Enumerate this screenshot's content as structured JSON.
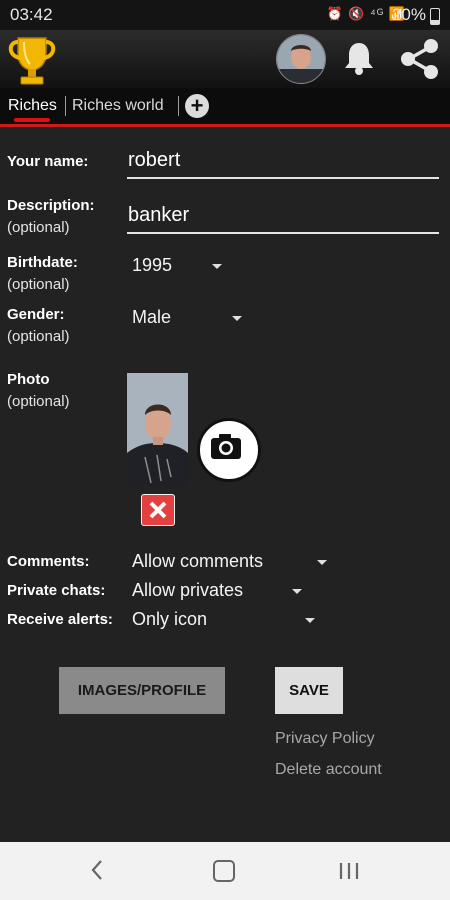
{
  "status_bar": {
    "time": "03:42",
    "icons": "⏰ 🔇 ⁴ᴳ 📶",
    "battery": "20%"
  },
  "app_bar": {
    "trophy_icon": "trophy-icon",
    "notification_icon": "bell-icon",
    "share_icon": "share-icon",
    "accent_color": "#d01a1a"
  },
  "tabs": [
    {
      "label": "Riches",
      "selected": true
    },
    {
      "label": "Riches world",
      "selected": false
    }
  ],
  "add_tab_label": "+",
  "form": {
    "name_label": "Your name:",
    "name_value": "robert",
    "description_label": "Description:",
    "description_optional": "(optional)",
    "description_value": "banker",
    "birthdate_label": "Birthdate:",
    "birthdate_optional": "(optional)",
    "birthdate_value": "1995",
    "gender_label": "Gender:",
    "gender_optional": "(optional)",
    "gender_value": "Male",
    "photo_label": "Photo",
    "photo_optional": "(optional)",
    "comments_label": "Comments:",
    "comments_value": "Allow comments",
    "private_chats_label": "Private chats:",
    "private_chats_value": "Allow privates",
    "alerts_label": "Receive alerts:",
    "alerts_value": "Only icon"
  },
  "buttons": {
    "images_profile": "IMAGES/PROFILE",
    "save": "SAVE"
  },
  "links": {
    "privacy_policy": "Privacy Policy",
    "delete_account": "Delete account"
  }
}
